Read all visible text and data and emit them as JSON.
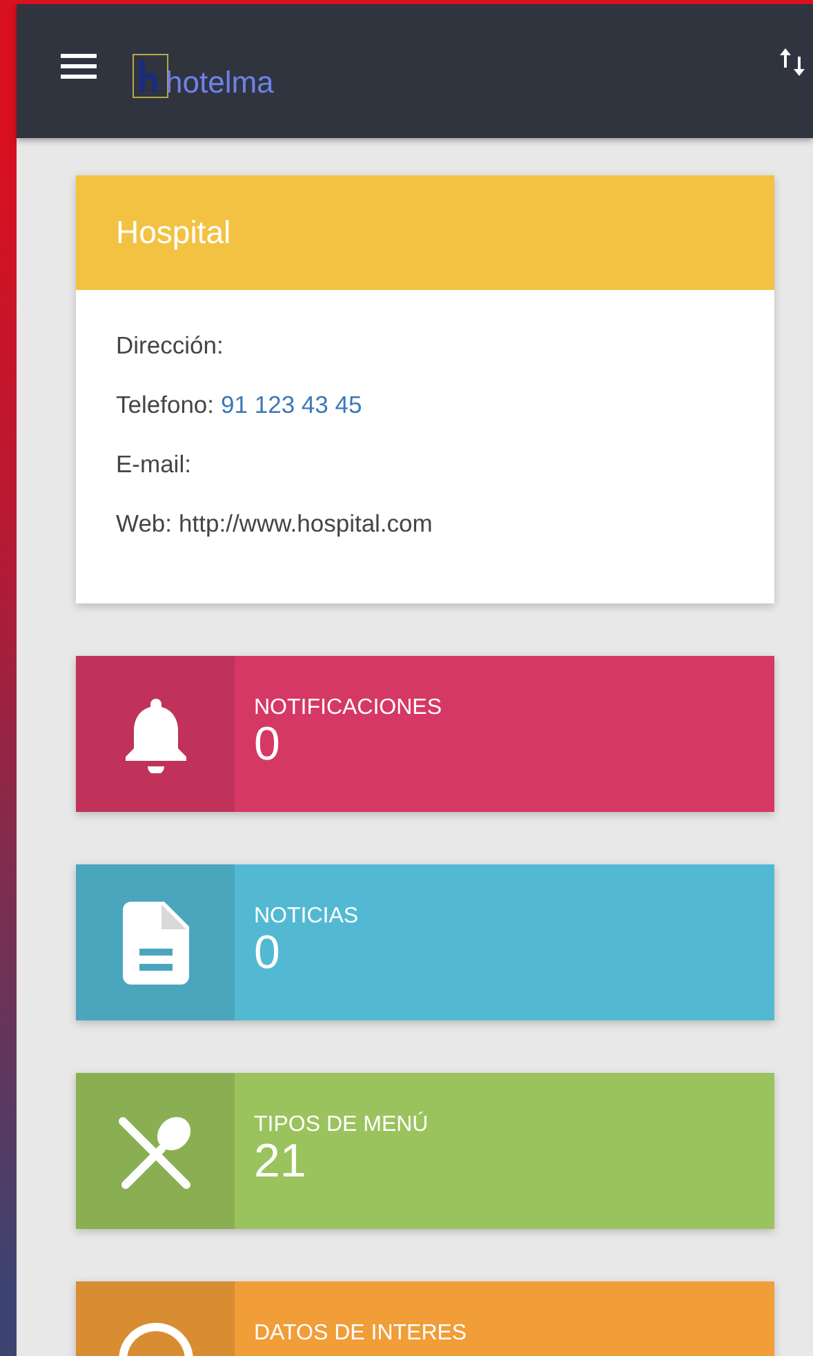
{
  "header": {
    "logo_text": "hotelma"
  },
  "hotel": {
    "name": "Hospital",
    "fields": [
      {
        "label": "Dirección:"
      },
      {
        "label": "Telefono:",
        "value": "91 123 43 45",
        "kind": "link"
      },
      {
        "label": "E-mail:"
      },
      {
        "label": "Web:",
        "value": "http://www.hospital.com",
        "kind": "text"
      }
    ]
  },
  "stats": [
    {
      "kind": "bell",
      "title": "NOTIFICACIONES",
      "count": "0",
      "color": "#d63864"
    },
    {
      "kind": "document",
      "title": "NOTICIAS",
      "count": "0",
      "color": "#53b9d3"
    },
    {
      "kind": "utensils",
      "title": "TIPOS DE MENÚ",
      "count": "21",
      "color": "#9ac35d"
    },
    {
      "kind": "info",
      "title": "DATOS DE INTERES",
      "color": "#f19d38"
    }
  ]
}
